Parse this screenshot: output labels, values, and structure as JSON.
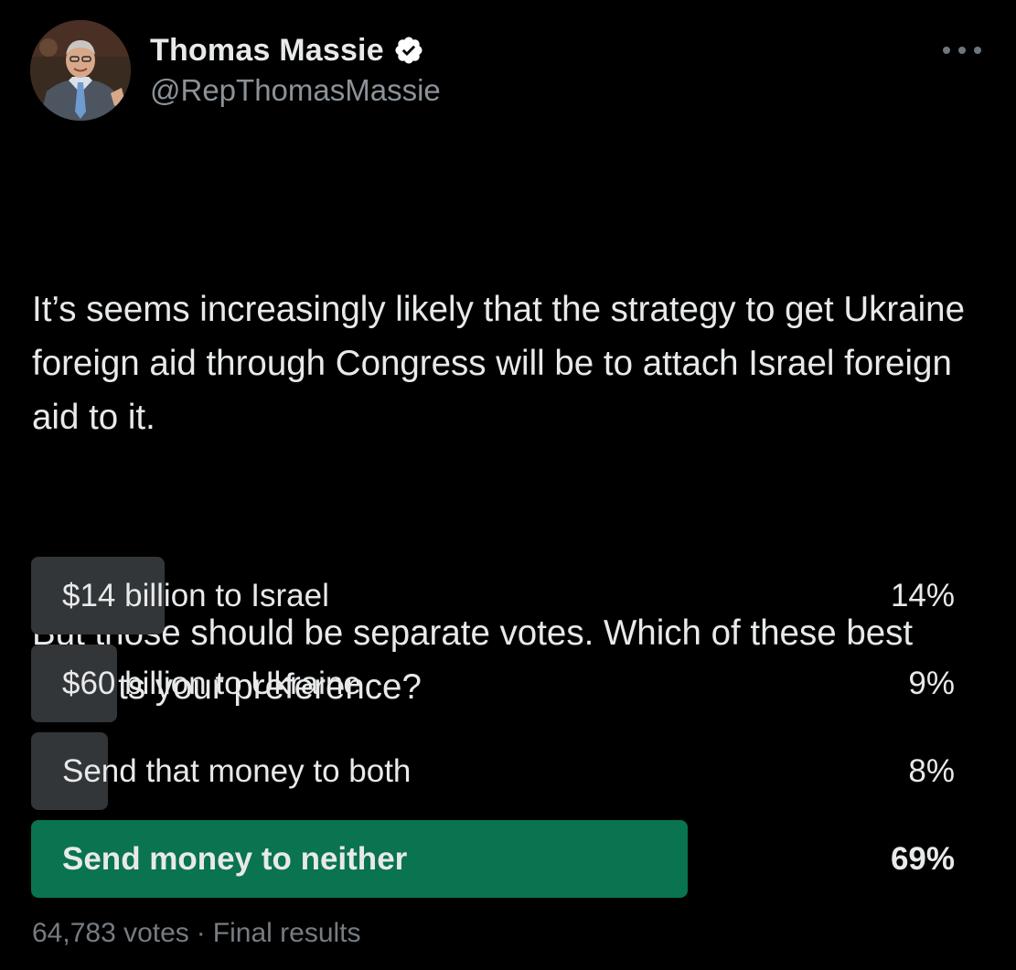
{
  "author": {
    "name": "Thomas Massie",
    "handle": "@RepThomasMassie",
    "verified": true,
    "verified_color": "#ffffff"
  },
  "icons": {
    "avatar": "avatar-photo",
    "verified": "verified-badge-icon",
    "more": "more-options-icon"
  },
  "tweet": {
    "paragraphs": [
      "It’s seems increasingly likely that the strategy to get Ukraine foreign aid through Congress will be to attach Israel foreign aid to it.",
      "But those should be separate votes. Which of these best reflects your preference?"
    ]
  },
  "poll": {
    "options": [
      {
        "label": "$14 billion to Israel",
        "percent_text": "14%",
        "share": 0.14,
        "winner": false
      },
      {
        "label": "$60 billion to Ukraine",
        "percent_text": "9%",
        "share": 0.09,
        "winner": false
      },
      {
        "label": "Send that money to both",
        "percent_text": "8%",
        "share": 0.08,
        "winner": false
      },
      {
        "label": "Send money to neither",
        "percent_text": "69%",
        "share": 0.69,
        "winner": true
      }
    ],
    "votes_text": "64,783 votes",
    "separator": "·",
    "status_text": "Final results",
    "colors": {
      "bar": "#333639",
      "winner_bar": "#0a7350"
    }
  }
}
